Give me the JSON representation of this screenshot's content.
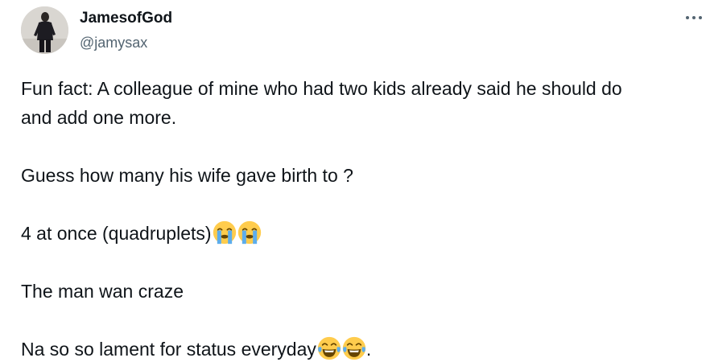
{
  "author": {
    "display_name": "JamesofGod",
    "handle": "@jamysax"
  },
  "menu": {
    "more_icon": "more-horizontal-icon"
  },
  "tweet": {
    "line1": "Fun fact: A colleague of mine who had two kids already said he should do",
    "line2": "and add one more.",
    "line3": "Guess how many his wife gave birth to ?",
    "line4": "4 at once (quadruplets)",
    "line5": "The man wan craze",
    "line6": "Na so so lament for status everyday",
    "line6_suffix": ".",
    "emojis": {
      "crying": "loudly-crying-face-emoji",
      "laughing": "face-with-tears-of-joy-emoji"
    }
  },
  "colors": {
    "text_primary": "#0f1419",
    "text_secondary": "#536471",
    "emoji_yellow": "#ffcc4d",
    "emoji_tears": "#5dadec"
  }
}
